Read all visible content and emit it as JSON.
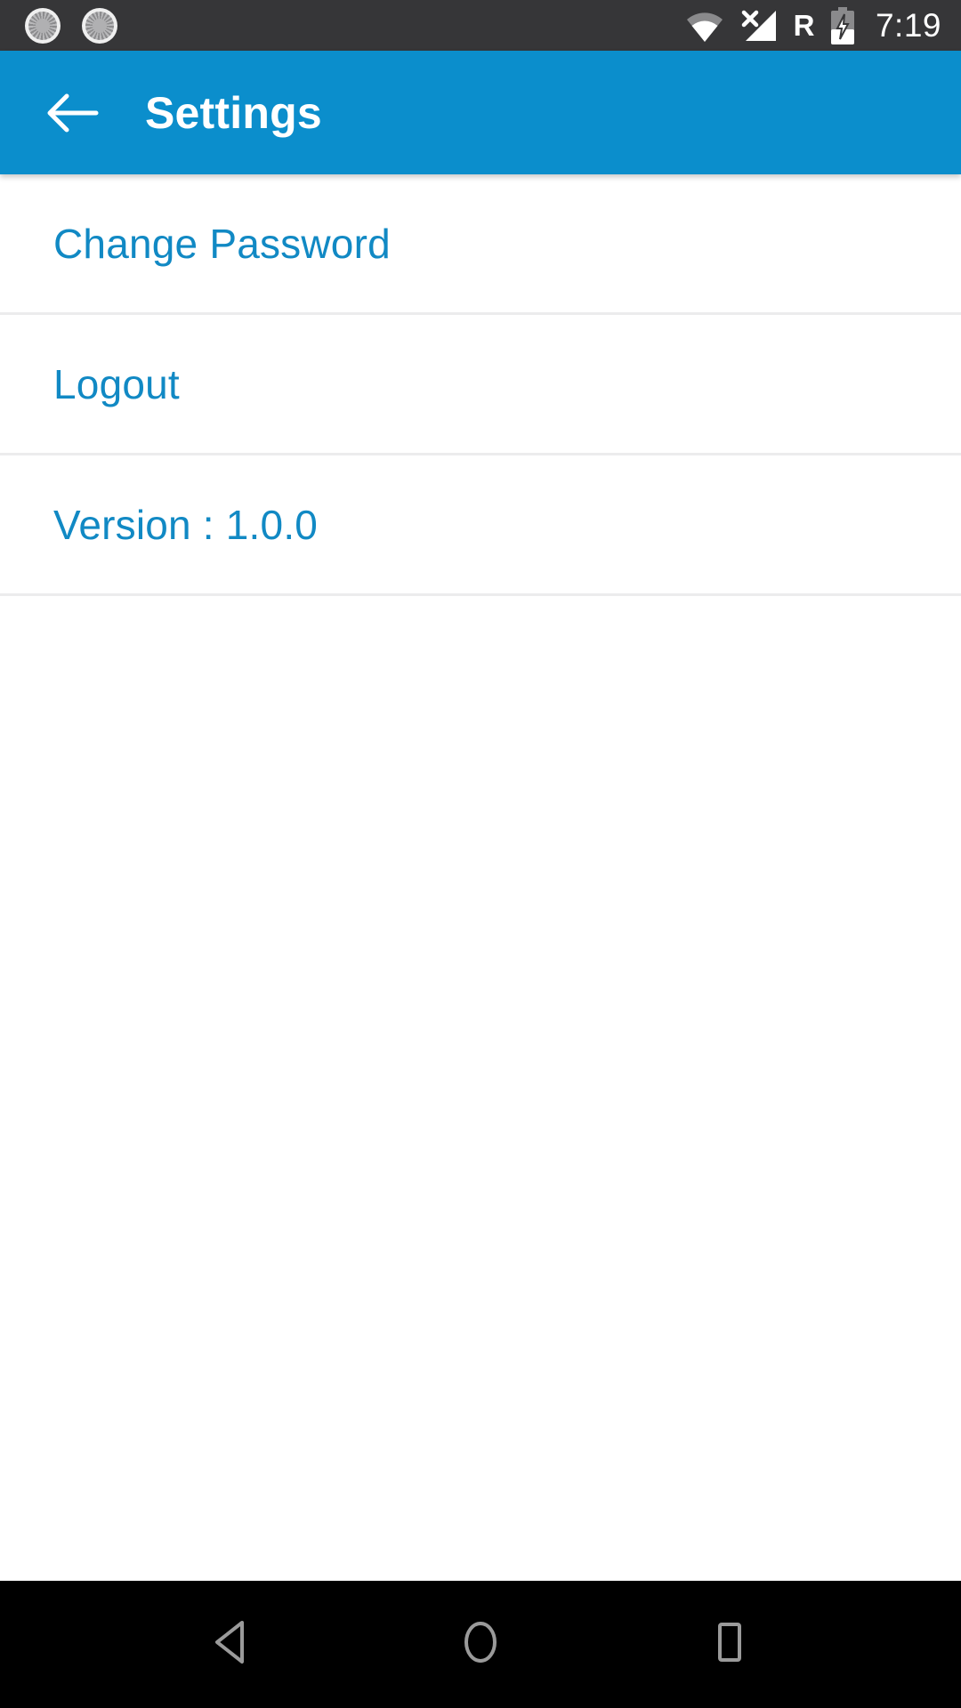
{
  "status_bar": {
    "background_color": "#363638",
    "notifications": [
      {
        "icon": "sync-spinner-icon"
      },
      {
        "icon": "sync-spinner-icon"
      }
    ],
    "wifi_icon": "wifi-partial-icon",
    "cellular_icon": "cellular-no-signal-icon",
    "roaming_indicator": "R",
    "battery_icon": "battery-charging-icon",
    "time": "7:19"
  },
  "app_bar": {
    "background_color": "#0b8ecc",
    "back_icon": "back-arrow-icon",
    "title": "Settings"
  },
  "settings_list": {
    "accent_color": "#1189c4",
    "divider_color": "#ececed",
    "items": [
      {
        "label": "Change Password",
        "name": "change-password"
      },
      {
        "label": "Logout",
        "name": "logout"
      },
      {
        "label": "Version : 1.0.0",
        "name": "version"
      }
    ]
  },
  "nav_bar": {
    "background_color": "#000000",
    "buttons": [
      {
        "icon": "nav-back-triangle-icon",
        "name": "nav-back-button"
      },
      {
        "icon": "nav-home-circle-icon",
        "name": "nav-home-button"
      },
      {
        "icon": "nav-recents-square-icon",
        "name": "nav-recents-button"
      }
    ]
  }
}
